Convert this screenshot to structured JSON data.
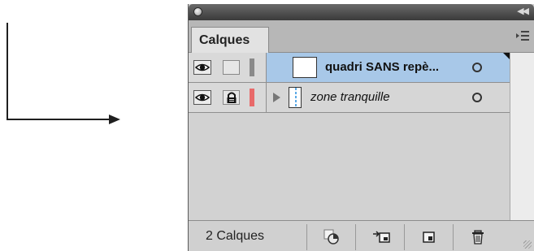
{
  "panel": {
    "tab_label": "Calques",
    "footer_count": "2 Calques"
  },
  "layers": [
    {
      "name": "quadri SANS repè...",
      "selected": true,
      "locked": false,
      "color": "#8a8a8a",
      "style": "bold"
    },
    {
      "name": "zone tranquille",
      "selected": false,
      "locked": true,
      "color": "#e86a6a",
      "style": "italic"
    }
  ],
  "icons": {
    "close": "close-icon",
    "collapse": "double-chevron-icon",
    "menu": "panel-menu-icon",
    "eye": "eye-icon",
    "lock": "lock-icon",
    "expand": "expand-triangle-icon",
    "target": "target-circle-icon",
    "make_clip": "clipping-mask-icon",
    "new_sublayer": "new-sublayer-icon",
    "new_layer": "new-layer-icon",
    "delete": "trash-icon"
  },
  "colors": {
    "selection": "#a8c8e8",
    "panel_bg": "#cfcfcf",
    "titlebar": "#3a3a3a"
  }
}
